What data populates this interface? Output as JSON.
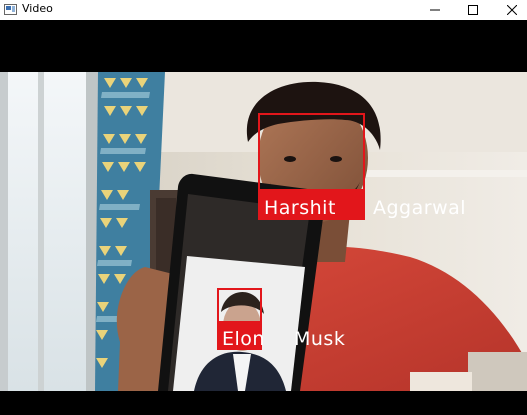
{
  "window": {
    "title": "Video",
    "icon": "video-app-icon",
    "controls": [
      "minimize-icon",
      "maximize-icon",
      "close-icon"
    ]
  },
  "detections": [
    {
      "first": "Harshit",
      "last": "Aggarwal"
    },
    {
      "first": "Elon",
      "last": "Musk"
    }
  ],
  "colors": {
    "box": "#e2161b",
    "label_text": "#ffffff"
  }
}
